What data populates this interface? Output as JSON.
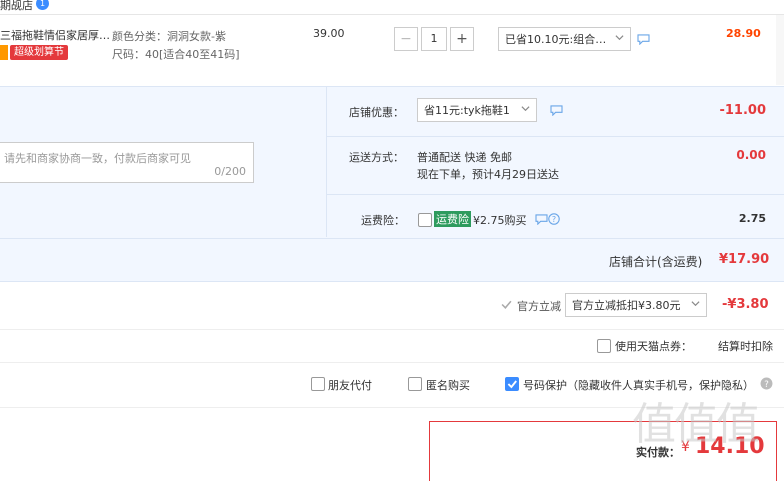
{
  "shop": {
    "name": "期觇店",
    "badge": "1"
  },
  "item": {
    "title": "三福拖鞋情侣家居厚…",
    "promo_tag": "超级划算节",
    "sku_line1": "颜色分类：洞洞女款-紫",
    "sku_line2": "尺码：40[适合40至41码]",
    "price": "39.00",
    "quantity": "1",
    "minus": "−",
    "plus": "+",
    "discount_select": "已省10.10元:组合…",
    "subtotal": "28.90"
  },
  "shop_section": {
    "message_placeholder": "请先和商家协商一致，付款后商家可见",
    "char_count": "0/200",
    "coupon_label": "店铺优惠：",
    "coupon_select": "省11元:tyk拖鞋1",
    "coupon_value": "-11.00",
    "shipping_label": "运送方式：",
    "shipping_method": "普通配送 快递 免邮",
    "shipping_eta": "现在下单，预计4月29日送达",
    "shipping_value": "0.00",
    "insurance_label": "运费险：",
    "insurance_tag": "运费险",
    "insurance_price": "¥2.75购买",
    "insurance_value": "2.75",
    "total_label": "店铺合计(含运费)",
    "total_value": "¥17.90"
  },
  "official": {
    "label": "官方立减",
    "select": "官方立减抵扣¥3.80元",
    "value": "-¥3.80"
  },
  "points": {
    "label": "使用天猫点券：",
    "value": "结算时扣除"
  },
  "options": {
    "friend_pay": "朋友代付",
    "anonymous": "匿名购买",
    "phone_protect": "号码保护（隐藏收件人真实手机号，保护隐私）"
  },
  "payment": {
    "label": "实付款：",
    "amount": "14.10"
  },
  "watermark": "值值值",
  "colors": {
    "accent_red": "#ff4400",
    "price_red": "#e4393c",
    "blue": "#3b8cff",
    "panel": "#f2f7ff"
  }
}
